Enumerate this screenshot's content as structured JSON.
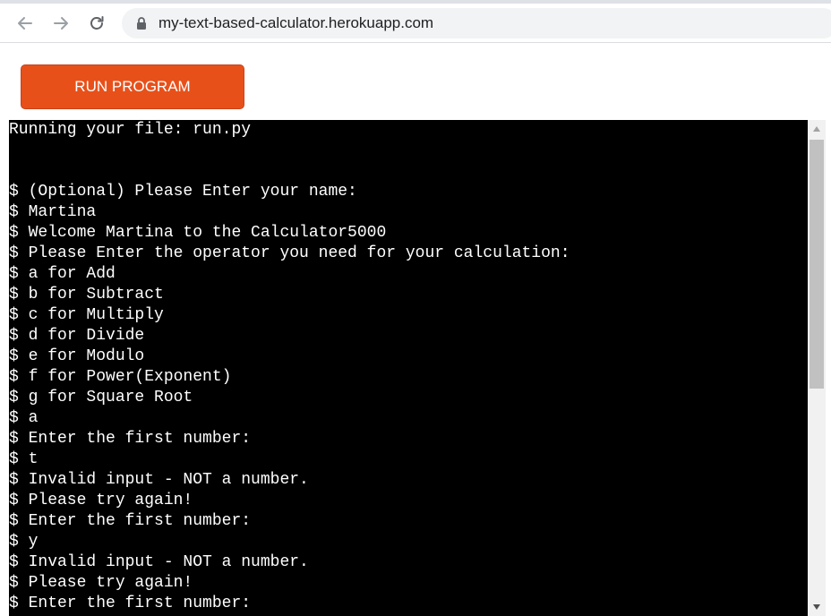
{
  "browser": {
    "url": "my-text-based-calculator.herokuapp.com",
    "icons": {
      "back": "arrow-left-icon",
      "forward": "arrow-right-icon",
      "reload": "reload-icon",
      "security": "lock-icon"
    }
  },
  "page": {
    "run_button_label": "RUN PROGRAM",
    "accent_color": "#e8501a"
  },
  "terminal": {
    "lines": [
      "Running your file: run.py",
      "",
      "",
      "$ (Optional) Please Enter your name:",
      "$ Martina",
      "$ Welcome Martina to the Calculator5000",
      "$ Please Enter the operator you need for your calculation:",
      "$ a for Add",
      "$ b for Subtract",
      "$ c for Multiply",
      "$ d for Divide",
      "$ e for Modulo",
      "$ f for Power(Exponent)",
      "$ g for Square Root",
      "$ a",
      "$ Enter the first number:",
      "$ t",
      "$ Invalid input - NOT a number.",
      "$ Please try again!",
      "$ Enter the first number:",
      "$ y",
      "$ Invalid input - NOT a number.",
      "$ Please try again!",
      "$ Enter the first number:"
    ]
  }
}
